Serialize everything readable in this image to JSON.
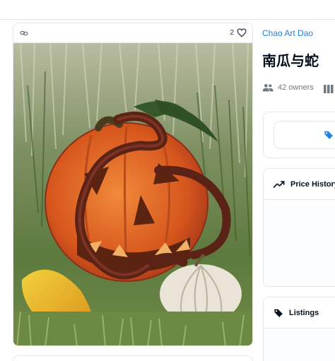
{
  "collection": {
    "name": "Chao Art Dao"
  },
  "item": {
    "title": "南瓜与蛇",
    "favorites": "2",
    "owners": "42 owners"
  },
  "panels": {
    "price_history": "Price History",
    "listings": "Listings"
  },
  "colors": {
    "link": "#2081e2",
    "border": "#e5e8eb",
    "muted": "#707a83"
  },
  "icons": [
    "link-icon",
    "heart-icon",
    "people-icon",
    "grid-icon",
    "tag-icon",
    "trend-icon"
  ]
}
